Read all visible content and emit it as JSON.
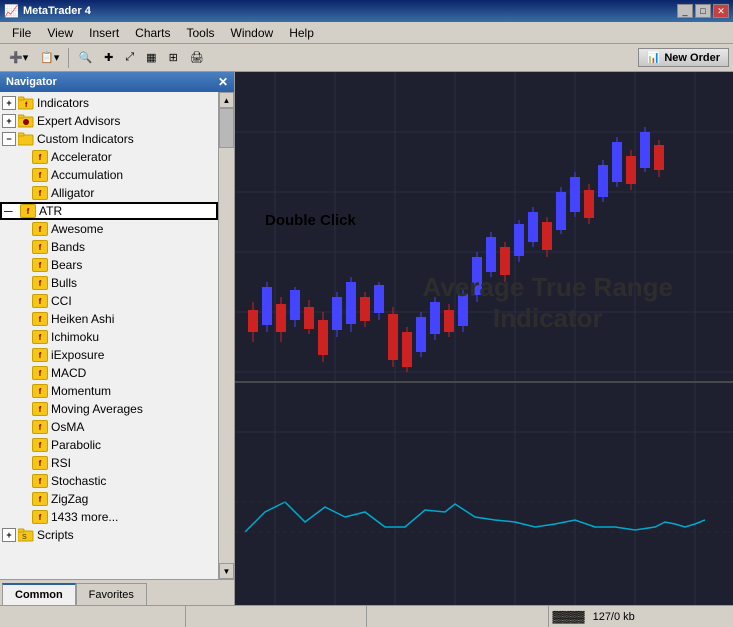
{
  "titleBar": {
    "title": "MetaTrader 4",
    "icon": "📈",
    "controls": [
      "_",
      "□",
      "✕"
    ]
  },
  "menuBar": {
    "items": [
      "File",
      "View",
      "Insert",
      "Charts",
      "Tools",
      "Window",
      "Help"
    ]
  },
  "toolbar": {
    "buttons": [
      "➕",
      "📋",
      "🔍",
      "✚",
      "🔗",
      "▦",
      "📊",
      "🖨"
    ],
    "newOrderLabel": "New Order"
  },
  "navigator": {
    "title": "Navigator",
    "tree": {
      "topLevel": [
        {
          "id": "indicators",
          "label": "Indicators",
          "expanded": false,
          "type": "folder"
        },
        {
          "id": "experts",
          "label": "Expert Advisors",
          "expanded": false,
          "type": "folder"
        },
        {
          "id": "custom",
          "label": "Custom Indicators",
          "expanded": true,
          "type": "folder",
          "children": [
            "Accelerator",
            "Accumulation",
            "Alligator",
            "ATR",
            "Awesome",
            "Bands",
            "Bears",
            "Bulls",
            "CCI",
            "Heiken Ashi",
            "Ichimoku",
            "iExposure",
            "MACD",
            "Momentum",
            "Moving Averages",
            "OsMA",
            "Parabolic",
            "RSI",
            "Stochastic",
            "ZigZag",
            "1433 more..."
          ]
        },
        {
          "id": "scripts",
          "label": "Scripts",
          "expanded": false,
          "type": "folder"
        }
      ]
    },
    "selectedItem": "ATR",
    "tabs": [
      {
        "id": "common",
        "label": "Common",
        "active": true
      },
      {
        "id": "favorites",
        "label": "Favorites",
        "active": false
      }
    ]
  },
  "chart": {
    "doubleClickLabel": "Double Click",
    "atrLabel": "Average True Range\nIndicator",
    "backgroundColor": "#1a2035",
    "upColor": "#4444ff",
    "downColor": "#cc2222",
    "lineColor": "#00aacc"
  },
  "statusBar": {
    "sections": [
      "",
      "",
      "",
      ""
    ],
    "scrollbarLabel": "▓▓▓▓",
    "memory": "127/0 kb"
  }
}
